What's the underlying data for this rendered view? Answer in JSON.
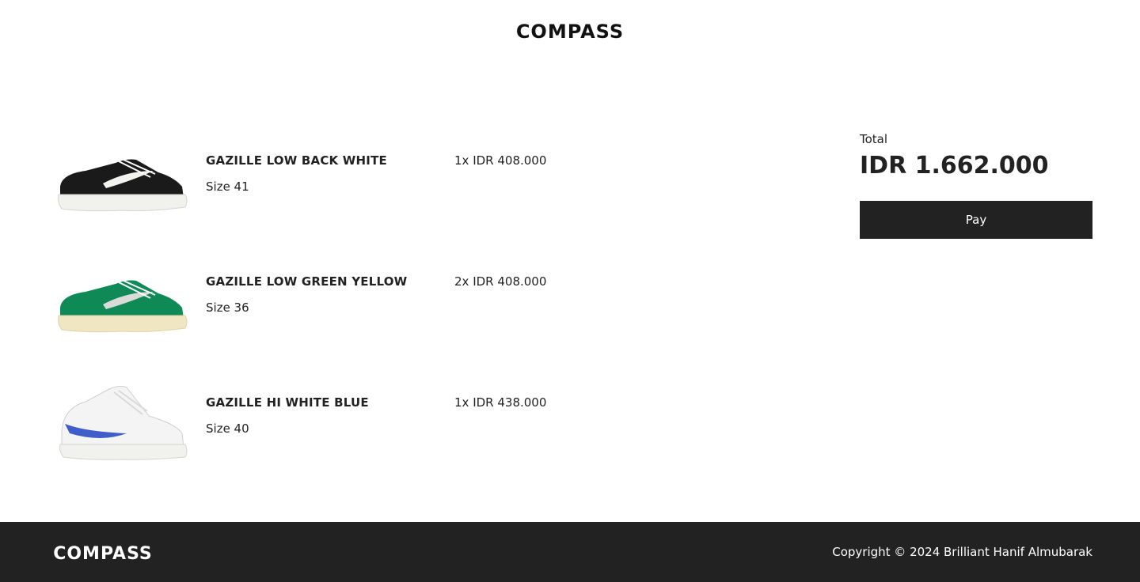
{
  "brand": {
    "name": "COMPASS"
  },
  "cart": {
    "items": [
      {
        "name": "GAZILLE LOW BACK WHITE",
        "size": "Size 41",
        "price": "1x IDR 408.000",
        "image_icon": "black-low-sneaker-image",
        "upper_color": "#1a1a1a",
        "swoosh_color": "#f2f2ee",
        "sole_color": "#f1f1ee"
      },
      {
        "name": "GAZILLE LOW GREEN YELLOW",
        "size": "Size 36",
        "price": "2x IDR 408.000",
        "image_icon": "green-low-sneaker-image",
        "upper_color": "#0f8a56",
        "swoosh_color": "#d8dbd8",
        "sole_color": "#f1e6c2"
      },
      {
        "name": "GAZILLE HI WHITE BLUE",
        "size": "Size 40",
        "price": "1x IDR 438.000",
        "image_icon": "white-high-sneaker-image",
        "upper_color": "#f4f4f4",
        "swoosh_color": "#3f5ec9",
        "sole_color": "#f1f1ee"
      }
    ]
  },
  "summary": {
    "total_label": "Total",
    "total_value": "IDR 1.662.000",
    "pay_label": "Pay"
  },
  "footer": {
    "copyright": "Copyright © 2024 Brilliant Hanif Almubarak"
  },
  "colors": {
    "dark": "#222222",
    "background": "#ffffff"
  }
}
